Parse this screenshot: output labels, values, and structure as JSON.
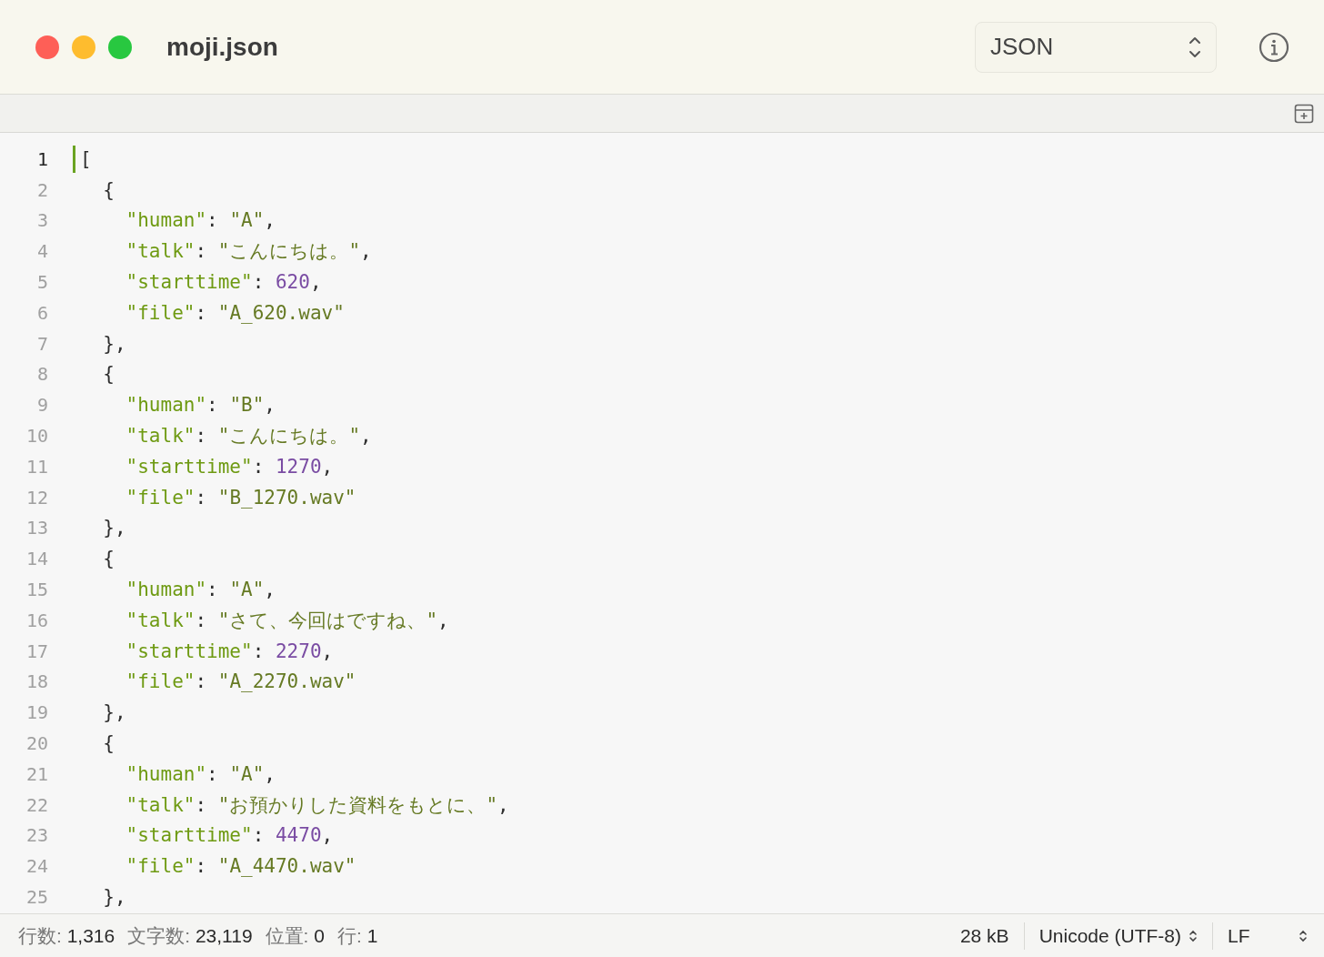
{
  "window": {
    "title": "moji.json"
  },
  "syntax_select": {
    "value": "JSON"
  },
  "editor": {
    "lines": [
      {
        "number": "1",
        "current": true,
        "tokens": [
          {
            "kind": "punct",
            "text": "["
          }
        ]
      },
      {
        "number": "2",
        "current": false,
        "tokens": [
          {
            "kind": "punct",
            "text": "  {"
          }
        ]
      },
      {
        "number": "3",
        "current": false,
        "tokens": [
          {
            "kind": "key",
            "text": "    \"human\""
          },
          {
            "kind": "punct",
            "text": ": "
          },
          {
            "kind": "string",
            "text": "\"A\""
          },
          {
            "kind": "punct",
            "text": ","
          }
        ]
      },
      {
        "number": "4",
        "current": false,
        "tokens": [
          {
            "kind": "key",
            "text": "    \"talk\""
          },
          {
            "kind": "punct",
            "text": ": "
          },
          {
            "kind": "string",
            "text": "\"こんにちは。\""
          },
          {
            "kind": "punct",
            "text": ","
          }
        ]
      },
      {
        "number": "5",
        "current": false,
        "tokens": [
          {
            "kind": "key",
            "text": "    \"starttime\""
          },
          {
            "kind": "punct",
            "text": ": "
          },
          {
            "kind": "number",
            "text": "620"
          },
          {
            "kind": "punct",
            "text": ","
          }
        ]
      },
      {
        "number": "6",
        "current": false,
        "tokens": [
          {
            "kind": "key",
            "text": "    \"file\""
          },
          {
            "kind": "punct",
            "text": ": "
          },
          {
            "kind": "string",
            "text": "\"A_620.wav\""
          }
        ]
      },
      {
        "number": "7",
        "current": false,
        "tokens": [
          {
            "kind": "punct",
            "text": "  },"
          }
        ]
      },
      {
        "number": "8",
        "current": false,
        "tokens": [
          {
            "kind": "punct",
            "text": "  {"
          }
        ]
      },
      {
        "number": "9",
        "current": false,
        "tokens": [
          {
            "kind": "key",
            "text": "    \"human\""
          },
          {
            "kind": "punct",
            "text": ": "
          },
          {
            "kind": "string",
            "text": "\"B\""
          },
          {
            "kind": "punct",
            "text": ","
          }
        ]
      },
      {
        "number": "10",
        "current": false,
        "tokens": [
          {
            "kind": "key",
            "text": "    \"talk\""
          },
          {
            "kind": "punct",
            "text": ": "
          },
          {
            "kind": "string",
            "text": "\"こんにちは。\""
          },
          {
            "kind": "punct",
            "text": ","
          }
        ]
      },
      {
        "number": "11",
        "current": false,
        "tokens": [
          {
            "kind": "key",
            "text": "    \"starttime\""
          },
          {
            "kind": "punct",
            "text": ": "
          },
          {
            "kind": "number",
            "text": "1270"
          },
          {
            "kind": "punct",
            "text": ","
          }
        ]
      },
      {
        "number": "12",
        "current": false,
        "tokens": [
          {
            "kind": "key",
            "text": "    \"file\""
          },
          {
            "kind": "punct",
            "text": ": "
          },
          {
            "kind": "string",
            "text": "\"B_1270.wav\""
          }
        ]
      },
      {
        "number": "13",
        "current": false,
        "tokens": [
          {
            "kind": "punct",
            "text": "  },"
          }
        ]
      },
      {
        "number": "14",
        "current": false,
        "tokens": [
          {
            "kind": "punct",
            "text": "  {"
          }
        ]
      },
      {
        "number": "15",
        "current": false,
        "tokens": [
          {
            "kind": "key",
            "text": "    \"human\""
          },
          {
            "kind": "punct",
            "text": ": "
          },
          {
            "kind": "string",
            "text": "\"A\""
          },
          {
            "kind": "punct",
            "text": ","
          }
        ]
      },
      {
        "number": "16",
        "current": false,
        "tokens": [
          {
            "kind": "key",
            "text": "    \"talk\""
          },
          {
            "kind": "punct",
            "text": ": "
          },
          {
            "kind": "string",
            "text": "\"さて、今回はですね、\""
          },
          {
            "kind": "punct",
            "text": ","
          }
        ]
      },
      {
        "number": "17",
        "current": false,
        "tokens": [
          {
            "kind": "key",
            "text": "    \"starttime\""
          },
          {
            "kind": "punct",
            "text": ": "
          },
          {
            "kind": "number",
            "text": "2270"
          },
          {
            "kind": "punct",
            "text": ","
          }
        ]
      },
      {
        "number": "18",
        "current": false,
        "tokens": [
          {
            "kind": "key",
            "text": "    \"file\""
          },
          {
            "kind": "punct",
            "text": ": "
          },
          {
            "kind": "string",
            "text": "\"A_2270.wav\""
          }
        ]
      },
      {
        "number": "19",
        "current": false,
        "tokens": [
          {
            "kind": "punct",
            "text": "  },"
          }
        ]
      },
      {
        "number": "20",
        "current": false,
        "tokens": [
          {
            "kind": "punct",
            "text": "  {"
          }
        ]
      },
      {
        "number": "21",
        "current": false,
        "tokens": [
          {
            "kind": "key",
            "text": "    \"human\""
          },
          {
            "kind": "punct",
            "text": ": "
          },
          {
            "kind": "string",
            "text": "\"A\""
          },
          {
            "kind": "punct",
            "text": ","
          }
        ]
      },
      {
        "number": "22",
        "current": false,
        "tokens": [
          {
            "kind": "key",
            "text": "    \"talk\""
          },
          {
            "kind": "punct",
            "text": ": "
          },
          {
            "kind": "string",
            "text": "\"お預かりした資料をもとに、\""
          },
          {
            "kind": "punct",
            "text": ","
          }
        ]
      },
      {
        "number": "23",
        "current": false,
        "tokens": [
          {
            "kind": "key",
            "text": "    \"starttime\""
          },
          {
            "kind": "punct",
            "text": ": "
          },
          {
            "kind": "number",
            "text": "4470"
          },
          {
            "kind": "punct",
            "text": ","
          }
        ]
      },
      {
        "number": "24",
        "current": false,
        "tokens": [
          {
            "kind": "key",
            "text": "    \"file\""
          },
          {
            "kind": "punct",
            "text": ": "
          },
          {
            "kind": "string",
            "text": "\"A_4470.wav\""
          }
        ]
      },
      {
        "number": "25",
        "current": false,
        "tokens": [
          {
            "kind": "punct",
            "text": "  },"
          }
        ]
      }
    ]
  },
  "status_bar": {
    "stats": [
      {
        "label": "行数:",
        "value": "1,316"
      },
      {
        "label": "文字数:",
        "value": "23,119"
      },
      {
        "label": "位置:",
        "value": "0"
      },
      {
        "label": "行:",
        "value": "1"
      }
    ],
    "file_size": "28 kB",
    "encoding": "Unicode (UTF-8)",
    "line_ending": "LF"
  }
}
